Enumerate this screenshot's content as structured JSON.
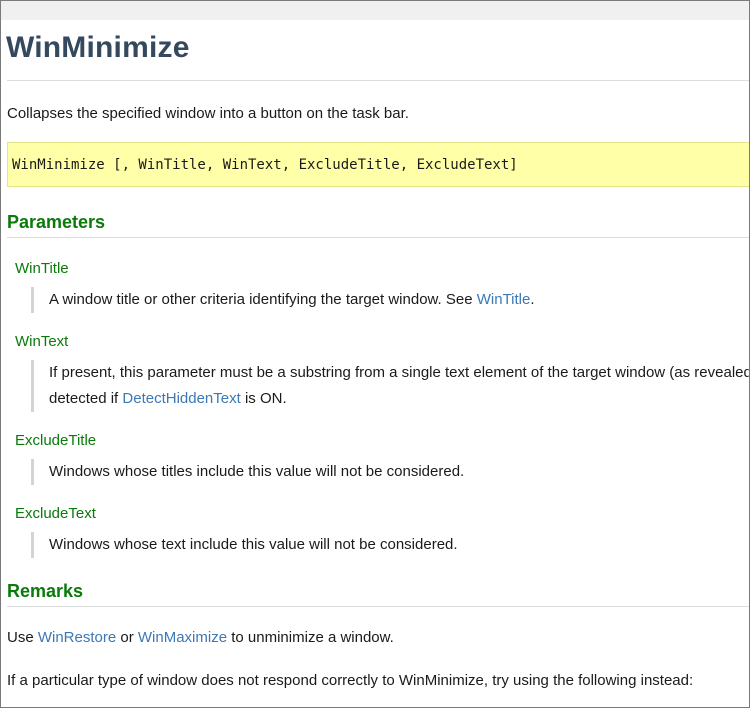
{
  "title": "WinMinimize",
  "description": "Collapses the specified window into a button on the task bar.",
  "syntax": "WinMinimize [, WinTitle, WinText, ExcludeTitle, ExcludeText]",
  "parameters_heading": "Parameters",
  "parameters": [
    {
      "name": "WinTitle",
      "text_before": "A window title or other criteria identifying the target window. See ",
      "link": "WinTitle",
      "text_after": "."
    },
    {
      "name": "WinText",
      "line1": "If present, this parameter must be a substring from a single text element of the target window (as revealed",
      "line2_before": "detected if ",
      "line2_link": "DetectHiddenText",
      "line2_after": " is ON."
    },
    {
      "name": "ExcludeTitle",
      "text": "Windows whose titles include this value will not be considered."
    },
    {
      "name": "ExcludeText",
      "text": "Windows whose text include this value will not be considered."
    }
  ],
  "remarks_heading": "Remarks",
  "remarks": {
    "p1_before": "Use ",
    "p1_link1": "WinRestore",
    "p1_mid": " or ",
    "p1_link2": "WinMaximize",
    "p1_after": " to unminimize a window.",
    "p2": "If a particular type of window does not respond correctly to WinMinimize, try using the following instead:"
  }
}
